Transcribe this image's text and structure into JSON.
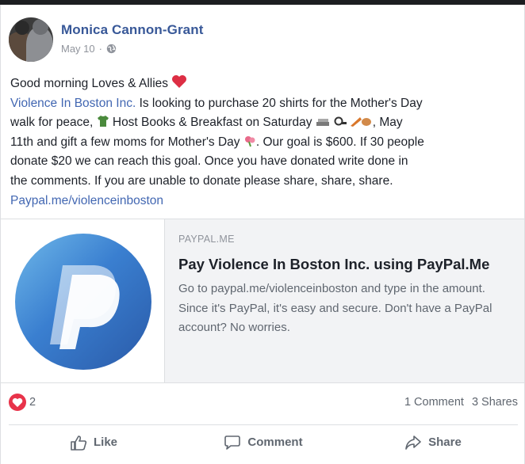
{
  "post": {
    "author": "Monica Cannon-Grant",
    "date": "May 10",
    "separator": "·",
    "privacy_icon": "globe-icon",
    "text": {
      "line1": "Good morning Loves & Allies",
      "line2_link": "Violence In Boston Inc.",
      "line2_rest": " Is looking to purchase 20 shirts for the Mother's Day",
      "line3_a": "walk for peace,",
      "line3_b": " Host Books & Breakfast on Saturday",
      "line3_c": ", May",
      "line4_a": "11th and gift a few moms for Mother's Day",
      "line4_b": ". Our goal is $600. If 30 people",
      "line5": "donate $20 we can reach this goal. Once you have donated write done in",
      "line6": "the comments. If you are unable to donate please share, share, share.",
      "line7_link": "Paypal.me/violenceinboston"
    },
    "emoji": {
      "heart": "heart-emoji",
      "shirt": "shirt-emoji",
      "books": "books-emoji",
      "flower": "flower-emoji"
    }
  },
  "preview": {
    "domain": "PAYPAL.ME",
    "title": "Pay Violence In Boston Inc. using PayPal.Me",
    "description": "Go to paypal.me/violenceinboston and type in the amount. Since it's PayPal, it's easy and secure. Don't have a PayPal account? No worries.",
    "logo": "paypal-logo"
  },
  "stats": {
    "reaction_icon": "heart-reaction-icon",
    "reaction_count": "2",
    "comments": "1 Comment",
    "shares": "3 Shares"
  },
  "actions": {
    "like": "Like",
    "comment": "Comment",
    "share": "Share"
  },
  "colors": {
    "link": "#4267b2",
    "author": "#385898",
    "reaction": "#e8334a"
  }
}
